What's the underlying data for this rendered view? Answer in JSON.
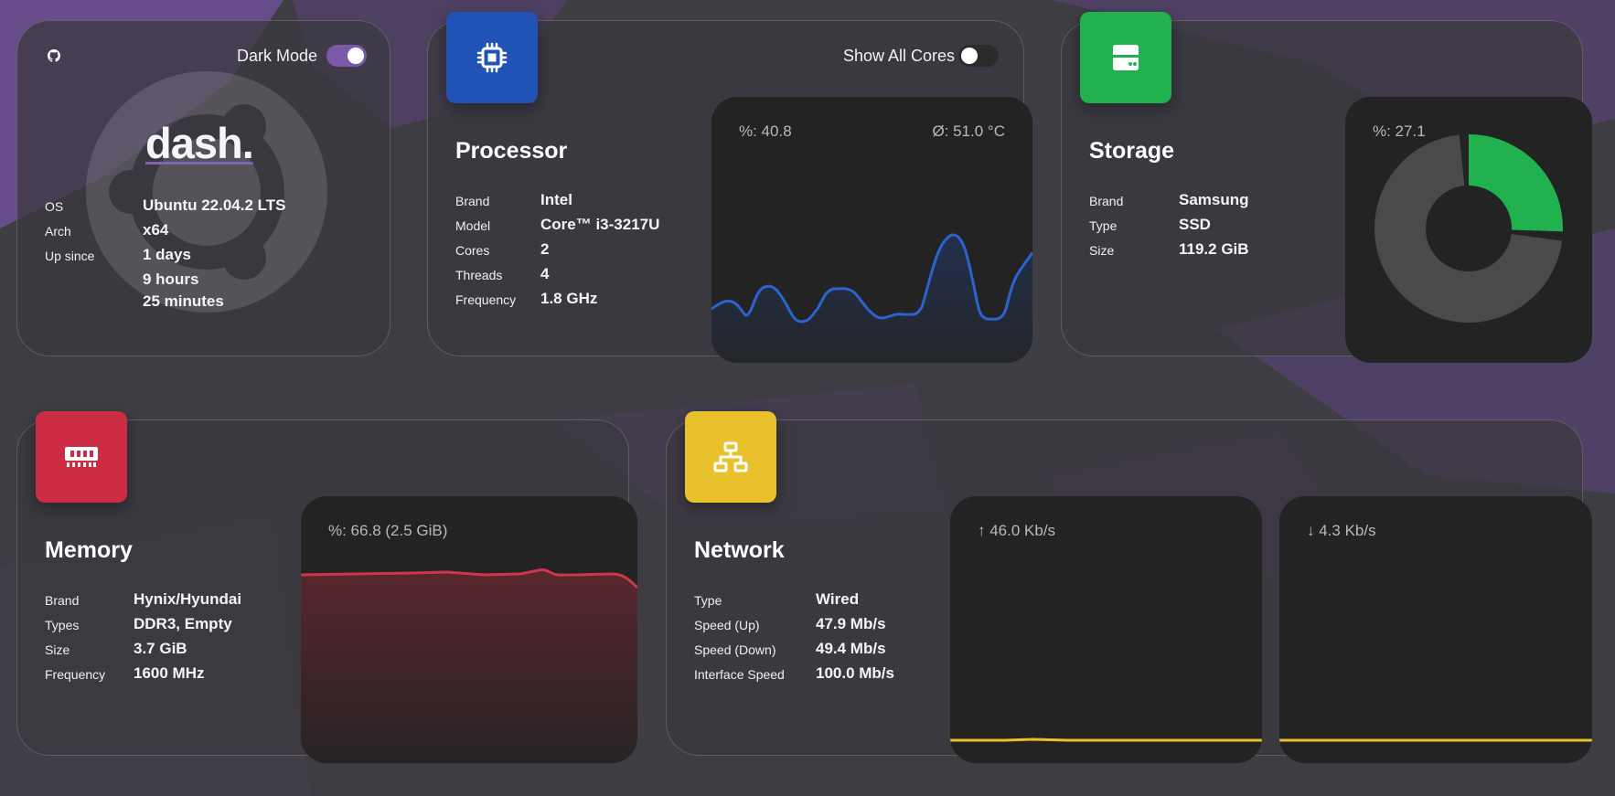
{
  "colors": {
    "processor": "#2152b6",
    "storage": "#21b24f",
    "memory": "#cc2d44",
    "network": "#e8c12c",
    "toggle_on": "#7a5aa8"
  },
  "dash": {
    "logo": "dash.",
    "github_icon": "github-icon",
    "dark_mode_label": "Dark Mode",
    "dark_mode_on": true,
    "rows": [
      {
        "label": "OS",
        "value": "Ubuntu 22.04.2 LTS"
      },
      {
        "label": "Arch",
        "value": "x64"
      },
      {
        "label": "Up since",
        "value": "1 days"
      }
    ],
    "uptime_extra": [
      "9 hours",
      "25 minutes"
    ]
  },
  "processor": {
    "title": "Processor",
    "icon": "cpu-icon",
    "show_all_cores_label": "Show All Cores",
    "show_all_cores_on": false,
    "rows": [
      {
        "label": "Brand",
        "value": "Intel"
      },
      {
        "label": "Model",
        "value": "Core™ i3-3217U"
      },
      {
        "label": "Cores",
        "value": "2"
      },
      {
        "label": "Threads",
        "value": "4"
      },
      {
        "label": "Frequency",
        "value": "1.8 GHz"
      }
    ],
    "usage_label": "%: 40.8",
    "temp_label": "Ø: 51.0 °C"
  },
  "storage": {
    "title": "Storage",
    "icon": "drive-icon",
    "rows": [
      {
        "label": "Brand",
        "value": "Samsung"
      },
      {
        "label": "Type",
        "value": "SSD"
      },
      {
        "label": "Size",
        "value": "119.2 GiB"
      }
    ],
    "usage_label": "%: 27.1",
    "used_percent": 27.1
  },
  "memory": {
    "title": "Memory",
    "icon": "ram-icon",
    "rows": [
      {
        "label": "Brand",
        "value": "Hynix/Hyundai"
      },
      {
        "label": "Types",
        "value": "DDR3, Empty"
      },
      {
        "label": "Size",
        "value": "3.7 GiB"
      },
      {
        "label": "Frequency",
        "value": "1600 MHz"
      }
    ],
    "usage_label": "%: 66.8 (2.5 GiB)"
  },
  "network": {
    "title": "Network",
    "icon": "network-icon",
    "rows": [
      {
        "label": "Type",
        "value": "Wired"
      },
      {
        "label": "Speed (Up)",
        "value": "47.9 Mb/s"
      },
      {
        "label": "Speed (Down)",
        "value": "49.4 Mb/s"
      },
      {
        "label": "Interface Speed",
        "value": "100.0 Mb/s"
      }
    ],
    "up_label": "↑ 46.0 Kb/s",
    "down_label": "↓ 4.3 Kb/s"
  }
}
